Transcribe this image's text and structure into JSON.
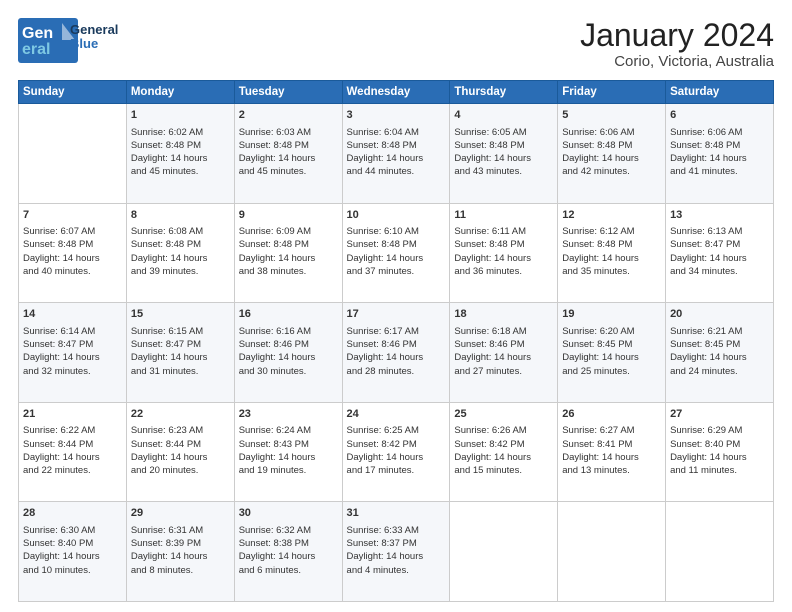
{
  "logo": {
    "line1": "General",
    "line2": "Blue"
  },
  "title": "January 2024",
  "subtitle": "Corio, Victoria, Australia",
  "header_days": [
    "Sunday",
    "Monday",
    "Tuesday",
    "Wednesday",
    "Thursday",
    "Friday",
    "Saturday"
  ],
  "weeks": [
    [
      {
        "day": "",
        "content": ""
      },
      {
        "day": "1",
        "content": "Sunrise: 6:02 AM\nSunset: 8:48 PM\nDaylight: 14 hours\nand 45 minutes."
      },
      {
        "day": "2",
        "content": "Sunrise: 6:03 AM\nSunset: 8:48 PM\nDaylight: 14 hours\nand 45 minutes."
      },
      {
        "day": "3",
        "content": "Sunrise: 6:04 AM\nSunset: 8:48 PM\nDaylight: 14 hours\nand 44 minutes."
      },
      {
        "day": "4",
        "content": "Sunrise: 6:05 AM\nSunset: 8:48 PM\nDaylight: 14 hours\nand 43 minutes."
      },
      {
        "day": "5",
        "content": "Sunrise: 6:06 AM\nSunset: 8:48 PM\nDaylight: 14 hours\nand 42 minutes."
      },
      {
        "day": "6",
        "content": "Sunrise: 6:06 AM\nSunset: 8:48 PM\nDaylight: 14 hours\nand 41 minutes."
      }
    ],
    [
      {
        "day": "7",
        "content": "Sunrise: 6:07 AM\nSunset: 8:48 PM\nDaylight: 14 hours\nand 40 minutes."
      },
      {
        "day": "8",
        "content": "Sunrise: 6:08 AM\nSunset: 8:48 PM\nDaylight: 14 hours\nand 39 minutes."
      },
      {
        "day": "9",
        "content": "Sunrise: 6:09 AM\nSunset: 8:48 PM\nDaylight: 14 hours\nand 38 minutes."
      },
      {
        "day": "10",
        "content": "Sunrise: 6:10 AM\nSunset: 8:48 PM\nDaylight: 14 hours\nand 37 minutes."
      },
      {
        "day": "11",
        "content": "Sunrise: 6:11 AM\nSunset: 8:48 PM\nDaylight: 14 hours\nand 36 minutes."
      },
      {
        "day": "12",
        "content": "Sunrise: 6:12 AM\nSunset: 8:48 PM\nDaylight: 14 hours\nand 35 minutes."
      },
      {
        "day": "13",
        "content": "Sunrise: 6:13 AM\nSunset: 8:47 PM\nDaylight: 14 hours\nand 34 minutes."
      }
    ],
    [
      {
        "day": "14",
        "content": "Sunrise: 6:14 AM\nSunset: 8:47 PM\nDaylight: 14 hours\nand 32 minutes."
      },
      {
        "day": "15",
        "content": "Sunrise: 6:15 AM\nSunset: 8:47 PM\nDaylight: 14 hours\nand 31 minutes."
      },
      {
        "day": "16",
        "content": "Sunrise: 6:16 AM\nSunset: 8:46 PM\nDaylight: 14 hours\nand 30 minutes."
      },
      {
        "day": "17",
        "content": "Sunrise: 6:17 AM\nSunset: 8:46 PM\nDaylight: 14 hours\nand 28 minutes."
      },
      {
        "day": "18",
        "content": "Sunrise: 6:18 AM\nSunset: 8:46 PM\nDaylight: 14 hours\nand 27 minutes."
      },
      {
        "day": "19",
        "content": "Sunrise: 6:20 AM\nSunset: 8:45 PM\nDaylight: 14 hours\nand 25 minutes."
      },
      {
        "day": "20",
        "content": "Sunrise: 6:21 AM\nSunset: 8:45 PM\nDaylight: 14 hours\nand 24 minutes."
      }
    ],
    [
      {
        "day": "21",
        "content": "Sunrise: 6:22 AM\nSunset: 8:44 PM\nDaylight: 14 hours\nand 22 minutes."
      },
      {
        "day": "22",
        "content": "Sunrise: 6:23 AM\nSunset: 8:44 PM\nDaylight: 14 hours\nand 20 minutes."
      },
      {
        "day": "23",
        "content": "Sunrise: 6:24 AM\nSunset: 8:43 PM\nDaylight: 14 hours\nand 19 minutes."
      },
      {
        "day": "24",
        "content": "Sunrise: 6:25 AM\nSunset: 8:42 PM\nDaylight: 14 hours\nand 17 minutes."
      },
      {
        "day": "25",
        "content": "Sunrise: 6:26 AM\nSunset: 8:42 PM\nDaylight: 14 hours\nand 15 minutes."
      },
      {
        "day": "26",
        "content": "Sunrise: 6:27 AM\nSunset: 8:41 PM\nDaylight: 14 hours\nand 13 minutes."
      },
      {
        "day": "27",
        "content": "Sunrise: 6:29 AM\nSunset: 8:40 PM\nDaylight: 14 hours\nand 11 minutes."
      }
    ],
    [
      {
        "day": "28",
        "content": "Sunrise: 6:30 AM\nSunset: 8:40 PM\nDaylight: 14 hours\nand 10 minutes."
      },
      {
        "day": "29",
        "content": "Sunrise: 6:31 AM\nSunset: 8:39 PM\nDaylight: 14 hours\nand 8 minutes."
      },
      {
        "day": "30",
        "content": "Sunrise: 6:32 AM\nSunset: 8:38 PM\nDaylight: 14 hours\nand 6 minutes."
      },
      {
        "day": "31",
        "content": "Sunrise: 6:33 AM\nSunset: 8:37 PM\nDaylight: 14 hours\nand 4 minutes."
      },
      {
        "day": "",
        "content": ""
      },
      {
        "day": "",
        "content": ""
      },
      {
        "day": "",
        "content": ""
      }
    ]
  ]
}
